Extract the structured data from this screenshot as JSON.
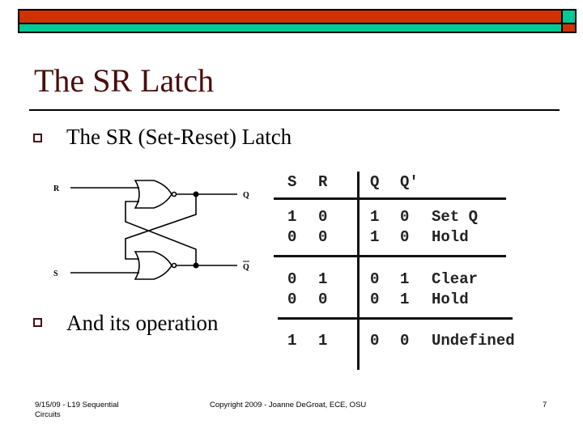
{
  "banner": {
    "colors": {
      "red": "#cc3300",
      "teal": "#00c896",
      "border": "#000000"
    }
  },
  "slide": {
    "title": "The SR Latch",
    "bullets": [
      {
        "text": "The SR (Set-Reset) Latch",
        "icon": "hollow-square-bullet"
      },
      {
        "text": "And its operation",
        "icon": "hollow-square-bullet"
      }
    ]
  },
  "circuit": {
    "inputs": {
      "top": "R",
      "bottom": "S"
    },
    "outputs": {
      "top": "Q",
      "bottom": "Q"
    },
    "gate_type": "NOR"
  },
  "truth_table": {
    "headers": [
      "S",
      "R",
      "Q",
      "Q′",
      ""
    ],
    "groups": [
      [
        [
          "1",
          "0",
          "1",
          "0",
          "Set Q"
        ],
        [
          "0",
          "0",
          "1",
          "0",
          "Hold"
        ]
      ],
      [
        [
          "0",
          "1",
          "0",
          "1",
          "Clear"
        ],
        [
          "0",
          "0",
          "0",
          "1",
          "Hold"
        ]
      ],
      [
        [
          "1",
          "1",
          "0",
          "0",
          "Undefined"
        ]
      ]
    ]
  },
  "footer": {
    "left_line1": "9/15/09 - L19 Sequential",
    "left_line2": "Circuits",
    "center": "Copyright 2009 - Joanne DeGroat, ECE, OSU",
    "page": "7"
  }
}
